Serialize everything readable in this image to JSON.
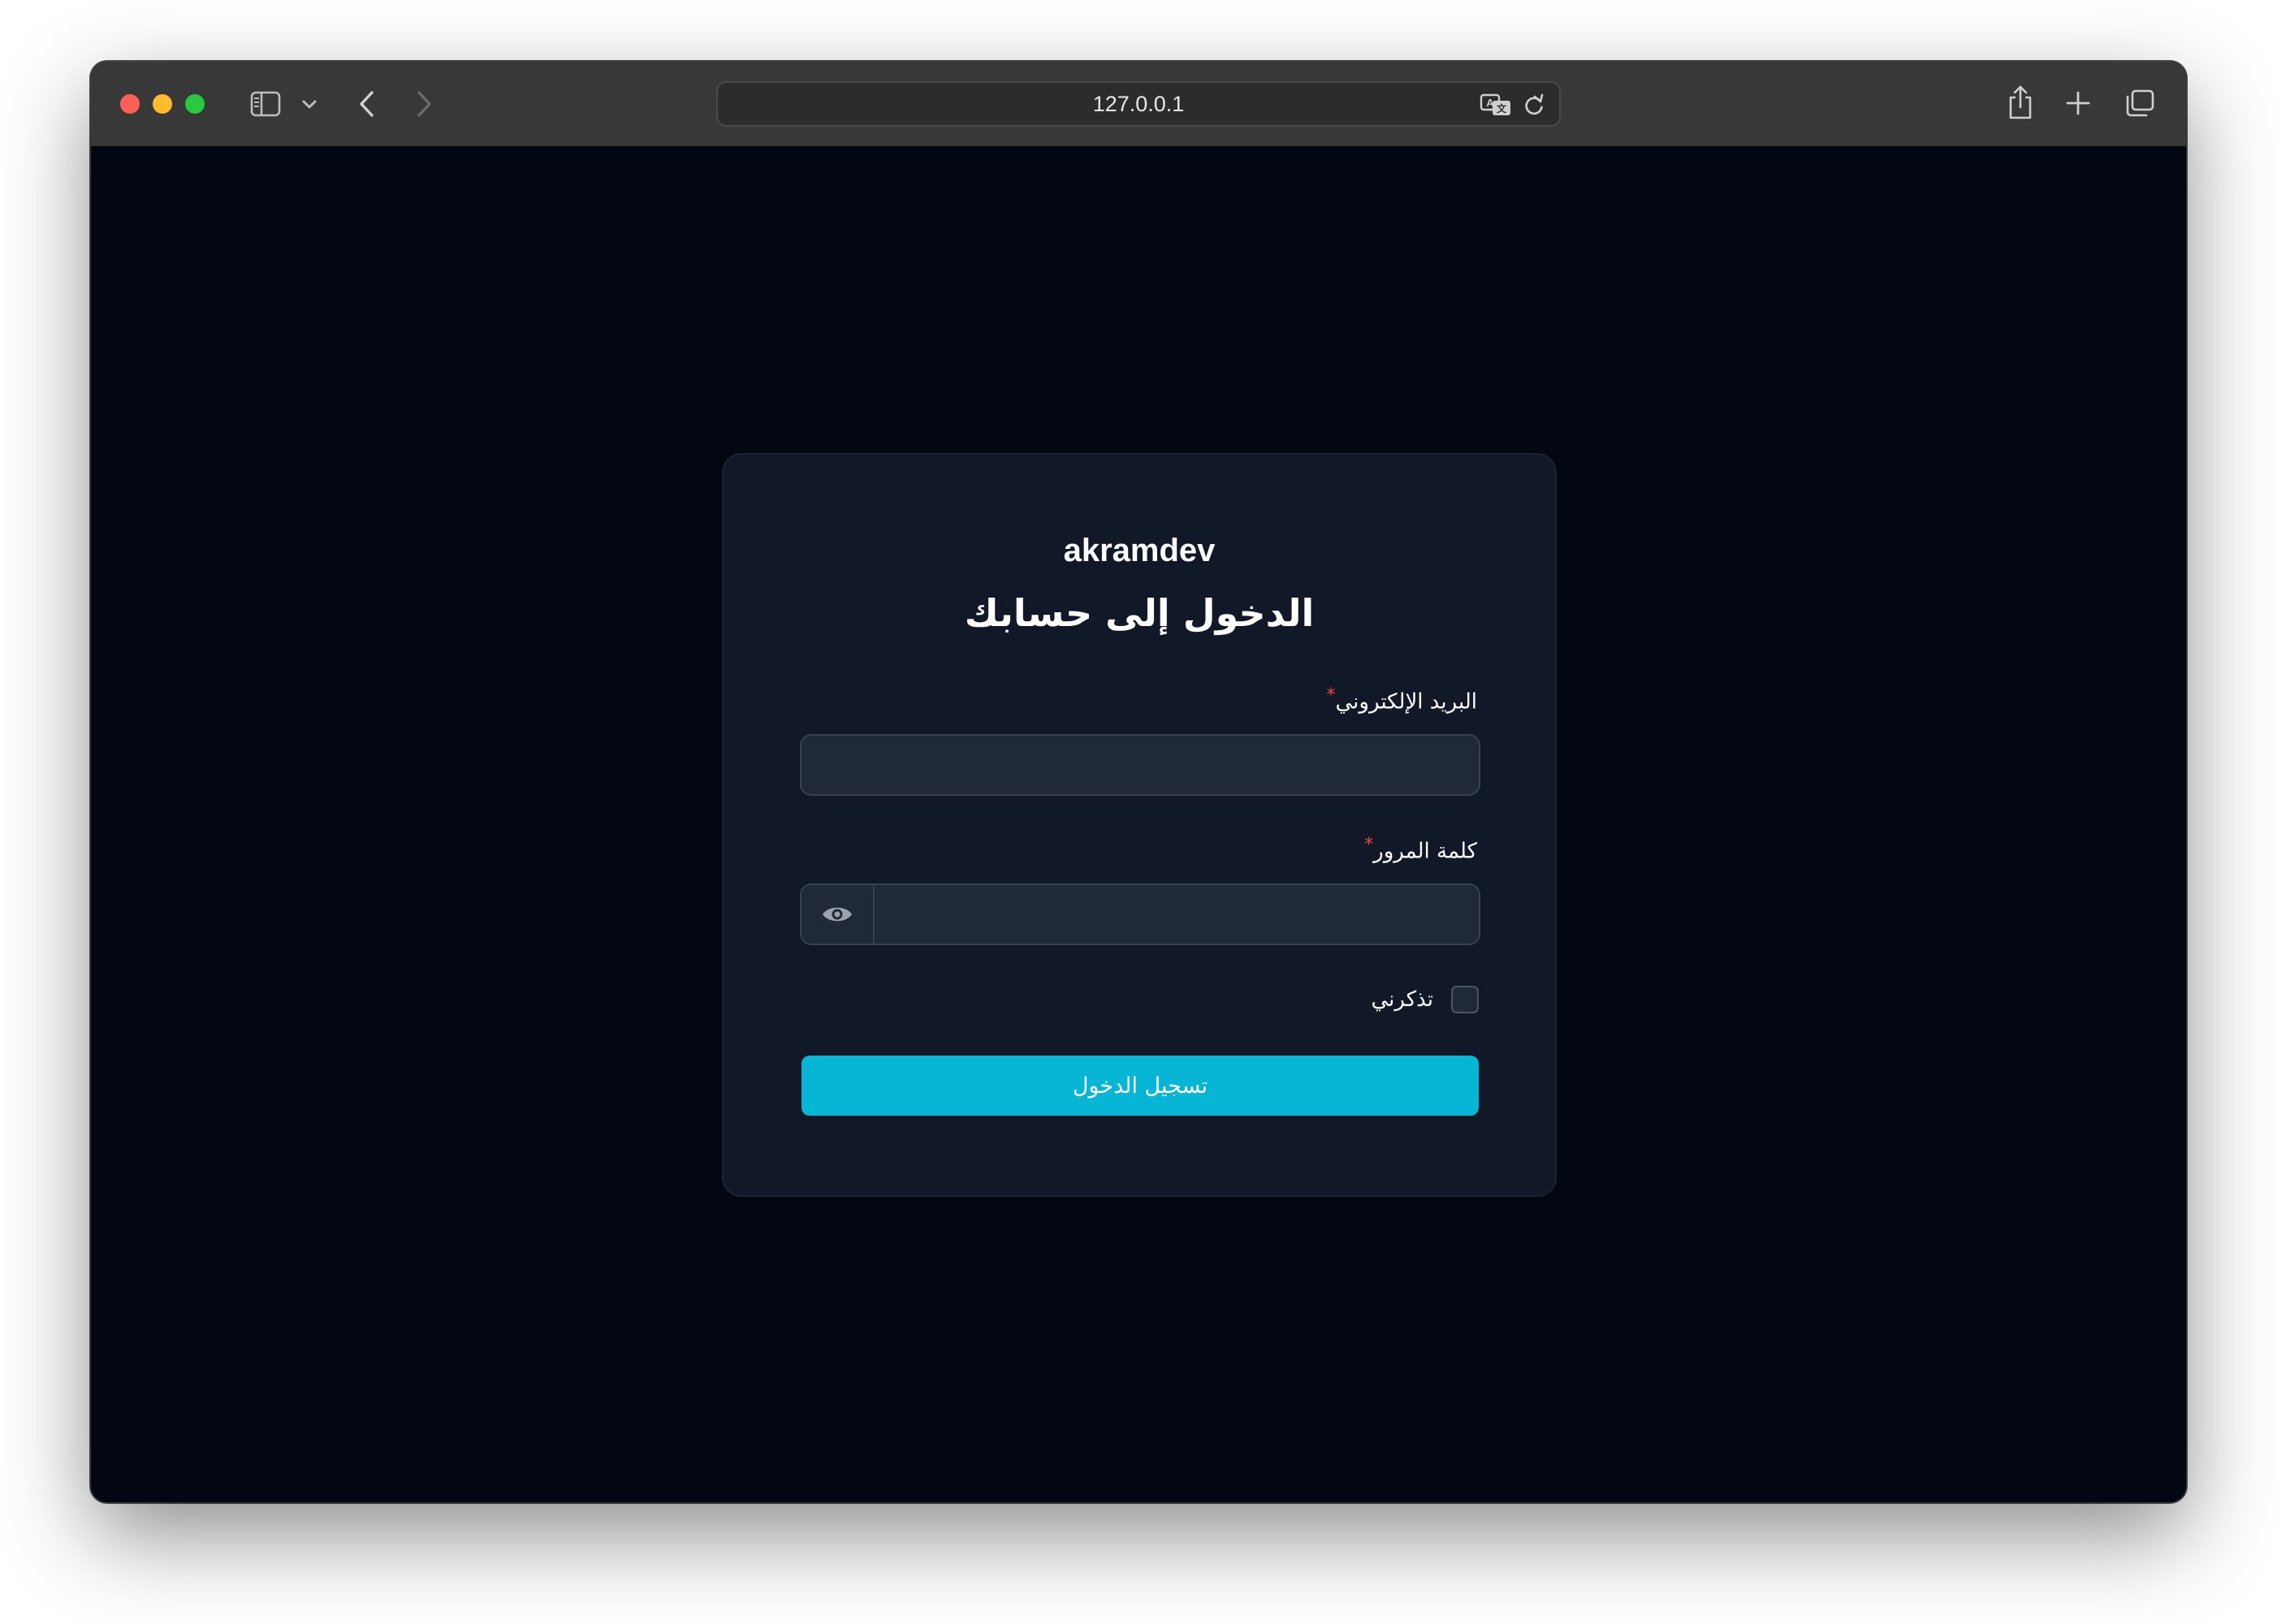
{
  "browser": {
    "url": "127.0.0.1",
    "traffic_lights": {
      "close": "#ff5f57",
      "minimize": "#febc2e",
      "zoom": "#28c840"
    },
    "icons": {
      "sidebar": "sidebar-icon",
      "chevron": "chevron-down-icon",
      "back": "back-arrow-icon",
      "forward": "forward-arrow-icon",
      "translate": "translate-icon",
      "reload": "reload-icon",
      "share": "share-icon",
      "new_tab": "plus-icon",
      "tabs": "tabs-overview-icon"
    }
  },
  "login": {
    "brand": "akramdev",
    "heading": "الدخول إلى حسابك",
    "email_label": "البريد الإلكتروني",
    "email_value": "",
    "password_label": "كلمة المرور",
    "password_value": "",
    "required_mark": "*",
    "remember_label": "تذكرني",
    "remember_checked": false,
    "submit_label": "تسجيل الدخول",
    "colors": {
      "page_bg": "#030712",
      "card_bg": "#111827",
      "input_bg": "#1f2937",
      "accent": "#06b6d4",
      "required": "#ef4444"
    }
  }
}
